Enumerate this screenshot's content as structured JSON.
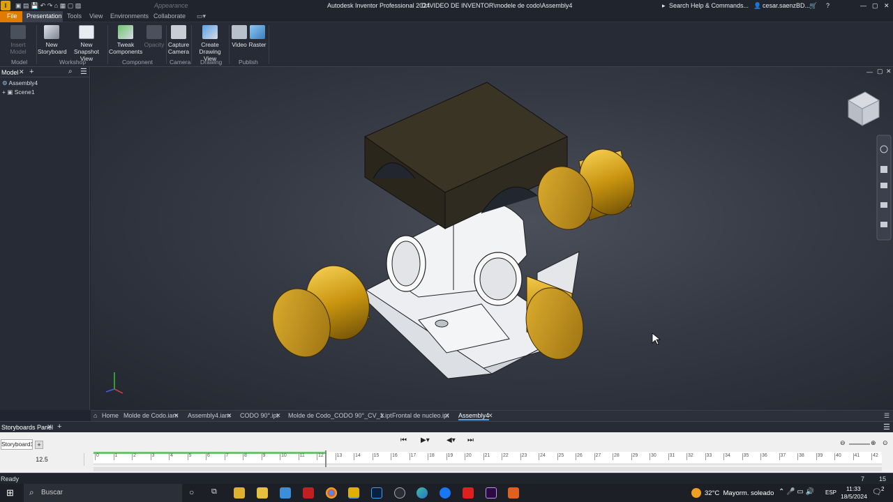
{
  "titlebar": {
    "appearance_label": "Appearance",
    "title": "Autodesk Inventor Professional 2024",
    "path": "D:\\VIDEO DE INVENTOR\\modele de codo\\Assembly4",
    "search": "Search Help & Commands...",
    "user": "cesar.saenzBD..."
  },
  "menu_tabs": [
    "File",
    "Presentation",
    "Tools",
    "View",
    "Environments",
    "Collaborate"
  ],
  "ribbon": {
    "buttons": [
      {
        "label": "Insert Model",
        "icon": "insert-model-icon",
        "disabled": true
      },
      {
        "label": "New Storyboard",
        "icon": "storyboard-icon"
      },
      {
        "label": "New Snapshot View",
        "icon": "snapshot-icon"
      },
      {
        "label": "Tweak Components",
        "icon": "tweak-icon"
      },
      {
        "label": "Opacity",
        "icon": "opacity-icon",
        "disabled": true
      },
      {
        "label": "Capture Camera",
        "icon": "camera-icon"
      },
      {
        "label": "Create Drawing View",
        "icon": "drawing-view-icon"
      },
      {
        "label": "Video",
        "icon": "video-icon"
      },
      {
        "label": "Raster",
        "icon": "raster-icon"
      }
    ],
    "groups": [
      "Model",
      "Workshop",
      "Component",
      "Camera",
      "Drawing",
      "Publish"
    ]
  },
  "browser": {
    "tab_label": "Model",
    "tree": [
      {
        "label": "Assembly4",
        "icon": "assembly-icon"
      },
      {
        "label": "Scene1",
        "icon": "scene-icon"
      }
    ]
  },
  "doc_tabs": [
    "Home",
    "Molde de Codo.iam",
    "Assembly4.iam",
    "CODO 90°.ipt",
    "Molde de Codo_CODO 90°_CV_1.ipt",
    "Frontal de nucleo.ipt",
    "Assembly4"
  ],
  "storyboard": {
    "panel_label": "Storyboards Panel",
    "tab_label": "Storyboard1",
    "current_time": "12.5",
    "ticks": [
      "0",
      "1",
      "2",
      "3",
      "4",
      "5",
      "6",
      "7",
      "8",
      "9",
      "10",
      "11",
      "12",
      "13",
      "14",
      "15",
      "16",
      "17",
      "18",
      "19",
      "20",
      "21",
      "22",
      "23",
      "24",
      "25",
      "26",
      "27",
      "28",
      "29",
      "30",
      "31",
      "32",
      "33",
      "34",
      "35",
      "36",
      "37",
      "38",
      "39",
      "40",
      "41",
      "42"
    ]
  },
  "status": {
    "text": "Ready",
    "num1": "7",
    "num2": "15"
  },
  "taskbar": {
    "search_placeholder": "Buscar",
    "weather": "32°C  Mayorm. soleado",
    "lang": "ESP",
    "time": "11:33",
    "date": "18/5/2024",
    "notif": "2"
  },
  "colors": {
    "accent": "#e07b00",
    "brass": "#c8940f",
    "active_tab": "#5aa0e6"
  }
}
